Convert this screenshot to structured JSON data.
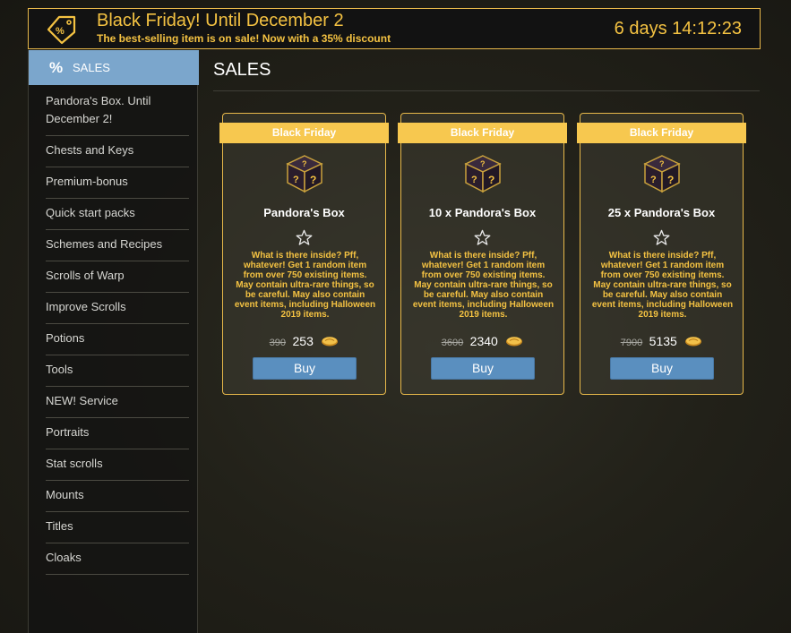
{
  "banner": {
    "title": "Black Friday! Until December 2",
    "subtitle": "The best-selling item is on sale! Now with a 35% discount",
    "countdown": "6 days 14:12:23",
    "icon": "discount-tag-icon",
    "accent_color": "#f4c242"
  },
  "sidebar": {
    "active": {
      "icon": "%",
      "label": "SALES"
    },
    "items": [
      "Pandora's Box. Until December 2!",
      "Chests and Keys",
      "Premium-bonus",
      "Quick start packs",
      "Schemes and Recipes",
      "Scrolls of Warp",
      "Improve Scrolls",
      "Potions",
      "Tools",
      "NEW! Service",
      "Portraits",
      "Stat scrolls",
      "Mounts",
      "Titles",
      "Cloaks"
    ]
  },
  "main": {
    "title": "SALES",
    "cards": [
      {
        "ribbon": "Black Friday",
        "name": "Pandora's Box",
        "description": "What is there inside? Pff, whatever! Get 1 random item from over 750 existing items. May contain ultra-rare things, so be careful. May also contain event items, including Halloween 2019 items.",
        "old_price": "390",
        "new_price": "253",
        "buy_label": "Buy"
      },
      {
        "ribbon": "Black Friday",
        "name": "10 x Pandora's Box",
        "description": "What is there inside? Pff, whatever! Get 1 random item from over 750 existing items. May contain ultra-rare things, so be careful. May also contain event items, including Halloween 2019 items.",
        "old_price": "3600",
        "new_price": "2340",
        "buy_label": "Buy"
      },
      {
        "ribbon": "Black Friday",
        "name": "25 x Pandora's Box",
        "description": "What is there inside? Pff, whatever! Get 1 random item from over 750 existing items. May contain ultra-rare things, so be careful. May also contain event items, including Halloween 2019 items.",
        "old_price": "7900",
        "new_price": "5135",
        "buy_label": "Buy"
      }
    ]
  }
}
